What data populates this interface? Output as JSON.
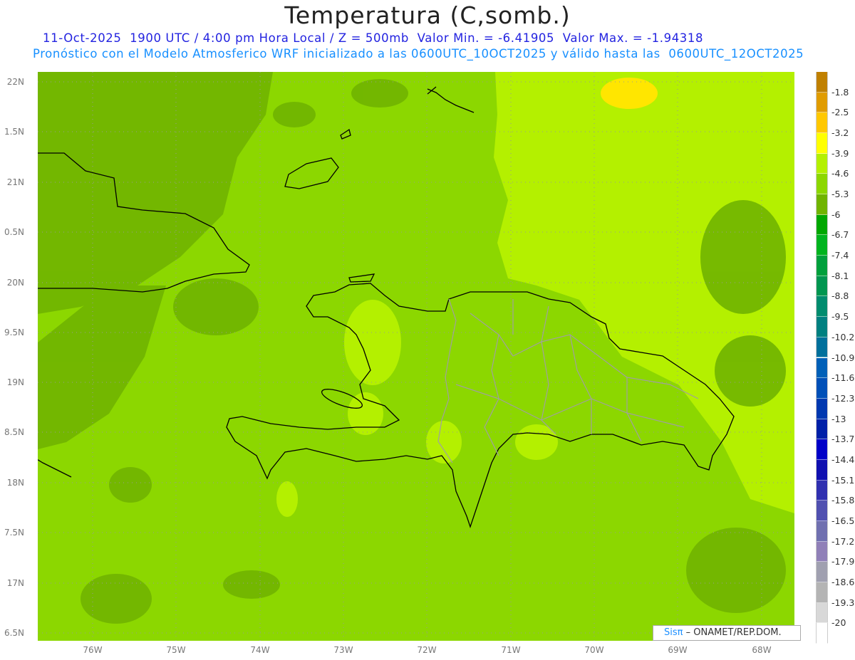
{
  "title": "Temperatura (C,somb.)",
  "subtitle_line1": "11-Oct-2025  1900 UTC / 4:00 pm Hora Local / Z = 500mb  Valor Min. = -6.41905  Valor Max. = -1.94318",
  "subtitle_line2": "Pronóstico con el Modelo Atmosferico WRF inicializado a las 0600UTC_10OCT2025 y válido hasta las  0600UTC_12OCT2025",
  "y_axis_labels": [
    "22N",
    "1.5N",
    "21N",
    "0.5N",
    "20N",
    "9.5N",
    "19N",
    "8.5N",
    "18N",
    "7.5N",
    "17N",
    "6.5N"
  ],
  "x_axis_labels": [
    "76W",
    "75W",
    "74W",
    "73W",
    "72W",
    "71W",
    "70W",
    "69W",
    "68W"
  ],
  "colorbar": {
    "labels": [
      "-1.8",
      "-2.5",
      "-3.2",
      "-3.9",
      "-4.6",
      "-5.3",
      "-6",
      "-6.7",
      "-7.4",
      "-8.1",
      "-8.8",
      "-9.5",
      "-10.2",
      "-10.9",
      "-11.6",
      "-12.3",
      "-13",
      "-13.7",
      "-14.4",
      "-15.1",
      "-15.8",
      "-16.5",
      "-17.2",
      "-17.9",
      "-18.6",
      "-19.3",
      "-20"
    ],
    "colors": [
      "#c08000",
      "#e09c00",
      "#ffc800",
      "#ffff00",
      "#b4f000",
      "#8cd700",
      "#70b400",
      "#00a800",
      "#00b41e",
      "#00a03c",
      "#009650",
      "#008c6e",
      "#008080",
      "#00709c",
      "#0060b8",
      "#0050b8",
      "#0038b0",
      "#0020a8",
      "#0000c8",
      "#1010b0",
      "#3030b0",
      "#5050b0",
      "#7070b0",
      "#9080b8",
      "#a0a0b0",
      "#b4b4b4",
      "#d8d8d8",
      "#ffffff"
    ]
  },
  "logo": {
    "brand": "Sisπ",
    "text": " – ONAMET/REP.DOM."
  },
  "colors": {
    "base": "#8cd700",
    "light": "#b4f000",
    "dark": "#70b400",
    "yellow": "#ffe600",
    "coast": "#000000",
    "border": "#a0a0a0"
  }
}
